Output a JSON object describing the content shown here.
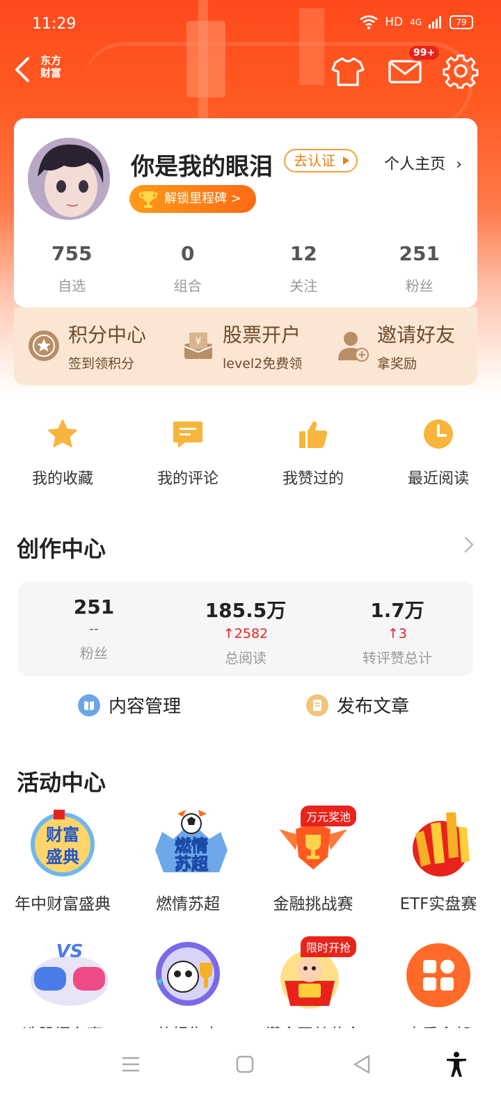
{
  "status": {
    "time": "11:29",
    "network": "HD",
    "signal": "4G",
    "battery": "79"
  },
  "header": {
    "brand_line1": "东方",
    "brand_line2": "财富",
    "mail_badge": "99+"
  },
  "profile": {
    "username": "你是我的眼泪",
    "verify_label": "去认证",
    "homepage_label": "个人主页",
    "milestone_label": "解锁里程碑 >",
    "stats": [
      {
        "value": "755",
        "label": "自选"
      },
      {
        "value": "0",
        "label": "组合"
      },
      {
        "value": "12",
        "label": "关注"
      },
      {
        "value": "251",
        "label": "粉丝"
      }
    ]
  },
  "quick": [
    {
      "title": "积分中心",
      "sub": "签到领积分",
      "icon": "points-icon"
    },
    {
      "title": "股票开户",
      "sub": "level2免费领",
      "icon": "account-open-icon"
    },
    {
      "title": "邀请好友",
      "sub": "拿奖励",
      "icon": "invite-friend-icon"
    }
  ],
  "shortcuts": [
    {
      "label": "我的收藏",
      "icon": "star-icon"
    },
    {
      "label": "我的评论",
      "icon": "comment-icon"
    },
    {
      "label": "我赞过的",
      "icon": "thumbs-up-icon"
    },
    {
      "label": "最近阅读",
      "icon": "clock-icon"
    }
  ],
  "creator": {
    "title": "创作中心",
    "stats": [
      {
        "value": "251",
        "delta": "--",
        "label": "粉丝"
      },
      {
        "value": "185.5万",
        "delta": "↑2582",
        "label": "总阅读"
      },
      {
        "value": "1.7万",
        "delta": "↑3",
        "label": "转评赞总计"
      }
    ],
    "manage_label": "内容管理",
    "publish_label": "发布文章"
  },
  "activities": {
    "title": "活动中心",
    "row1": [
      {
        "label": "年中财富盛典",
        "badge": "",
        "art_text": "财富盛典"
      },
      {
        "label": "燃情苏超",
        "badge": "",
        "art_text": "燃情苏超"
      },
      {
        "label": "金融挑战赛",
        "badge": "万元奖池",
        "art_text": ""
      },
      {
        "label": "ETF实盘赛",
        "badge": "",
        "art_text": ""
      }
    ],
    "row2": [
      {
        "label": "选股擂台赛",
        "badge": "",
        "art_text": "VS"
      },
      {
        "label": "苏超集卡",
        "badge": "",
        "art_text": ""
      },
      {
        "label": "攒金豆兑黄金",
        "badge": "限时开抢",
        "art_text": ""
      },
      {
        "label": "查看全部",
        "badge": "",
        "art_text": ""
      }
    ]
  },
  "colors": {
    "accent": "#ff5a22",
    "gold": "#f2a23a",
    "up_red": "#e8231b"
  }
}
